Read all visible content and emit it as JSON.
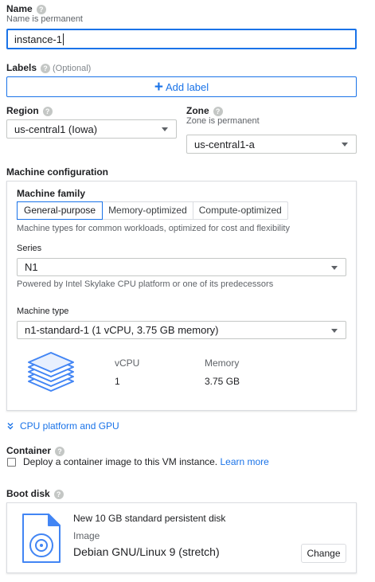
{
  "name": {
    "label": "Name",
    "hint": "Name is permanent",
    "value": "instance-1"
  },
  "labels": {
    "label": "Labels",
    "optional": "(Optional)",
    "add_button": "Add label"
  },
  "region": {
    "label": "Region",
    "value": "us-central1 (Iowa)"
  },
  "zone": {
    "label": "Zone",
    "hint": "Zone is permanent",
    "value": "us-central1-a"
  },
  "machine_config": {
    "heading": "Machine configuration",
    "family_label": "Machine family",
    "tabs": [
      "General-purpose",
      "Memory-optimized",
      "Compute-optimized"
    ],
    "active_tab": "General-purpose",
    "family_desc": "Machine types for common workloads, optimized for cost and flexibility",
    "series_label": "Series",
    "series_value": "N1",
    "series_desc": "Powered by Intel Skylake CPU platform or one of its predecessors",
    "type_label": "Machine type",
    "type_value": "n1-standard-1 (1 vCPU, 3.75 GB memory)",
    "vcpu_header": "vCPU",
    "memory_header": "Memory",
    "vcpu_value": "1",
    "memory_value": "3.75 GB"
  },
  "cpu_platform_link": "CPU platform and GPU",
  "container": {
    "label": "Container",
    "checkbox_text": "Deploy a container image to this VM instance.",
    "learn_more": "Learn more",
    "checked": false
  },
  "boot_disk": {
    "label": "Boot disk",
    "title": "New 10 GB standard persistent disk",
    "image_label": "Image",
    "image_value": "Debian GNU/Linux 9 (stretch)",
    "change_button": "Change"
  },
  "colors": {
    "accent": "#1a73e8",
    "border": "#dadce0",
    "icon_blue": "#4285f4"
  },
  "icons": [
    "help-icon",
    "plus-icon",
    "dropdown-caret-icon",
    "chevron-double-down-icon",
    "machine-stack-icon",
    "disk-icon"
  ]
}
